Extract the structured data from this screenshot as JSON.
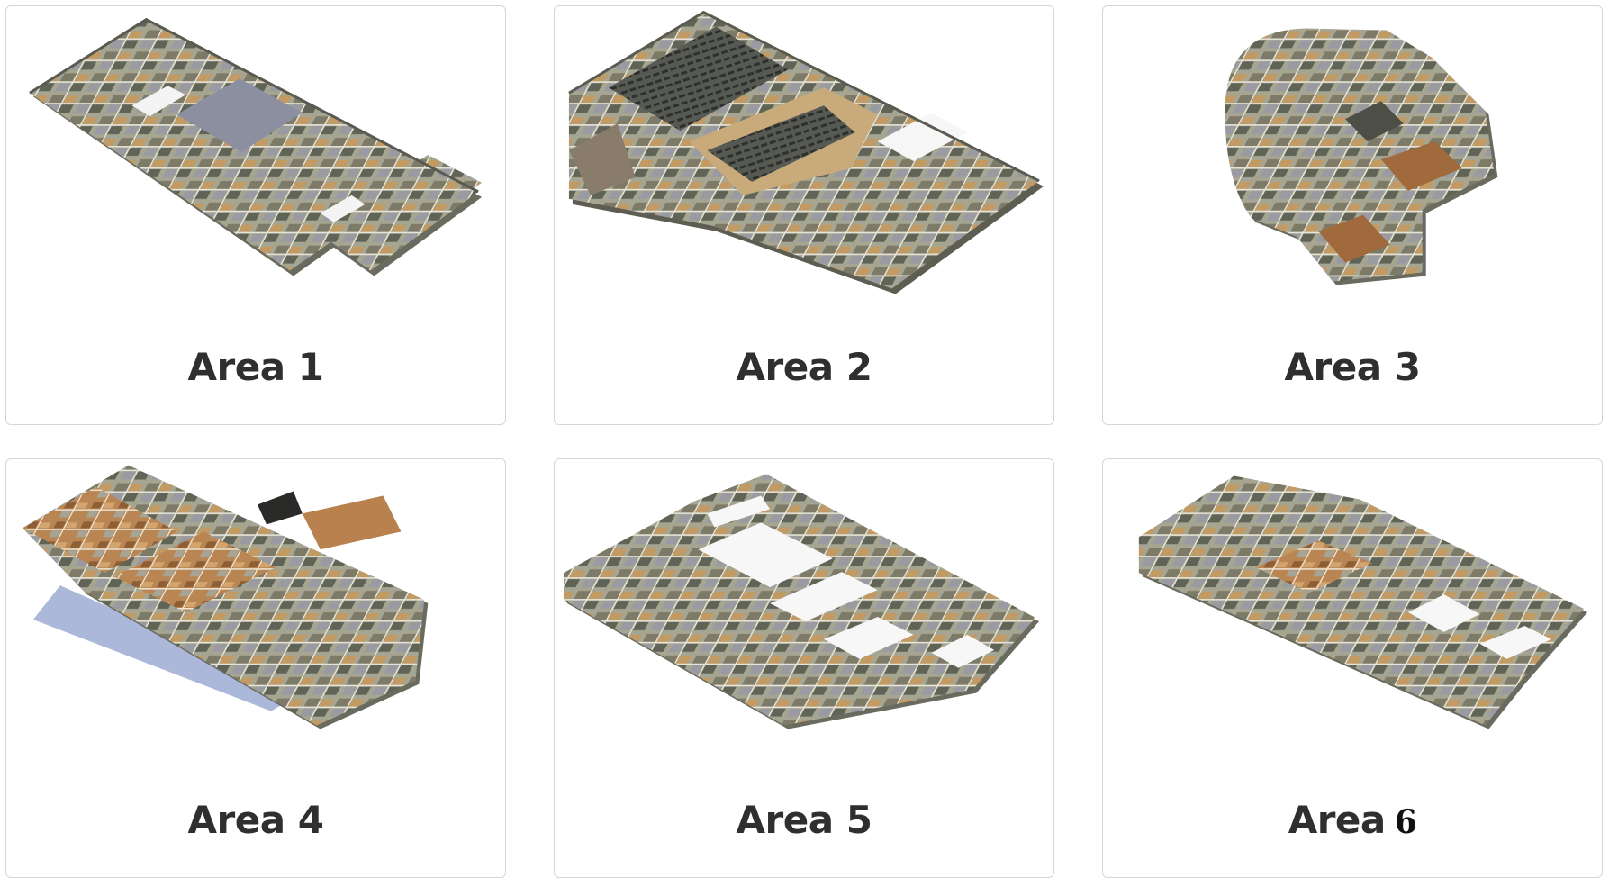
{
  "areas": [
    {
      "label": "Area 1"
    },
    {
      "label": "Area 2"
    },
    {
      "label": "Area 3"
    },
    {
      "label": "Area 4"
    },
    {
      "label": "Area 5"
    },
    {
      "label": "Area",
      "label_num": "6"
    }
  ],
  "colors": {
    "card_border": "#d6d6d6",
    "wall": "#9c9d8b",
    "wall_dark": "#6e6f62",
    "floor_wood": "#b98a55",
    "floor_gray": "#8f929a",
    "accent_blue": "#8fa6d6"
  }
}
